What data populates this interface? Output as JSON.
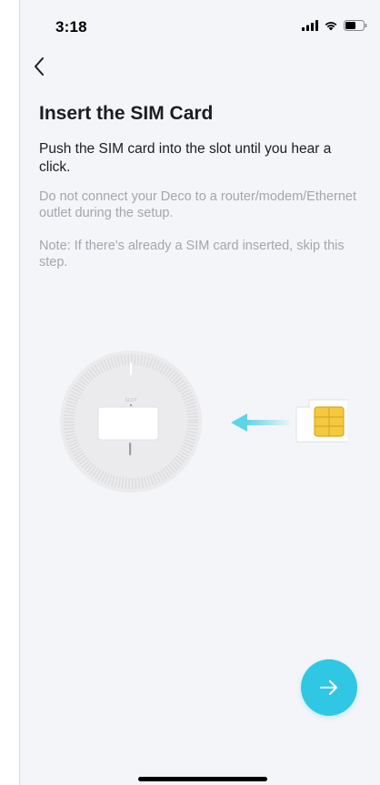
{
  "status_bar": {
    "time": "3:18",
    "icons": [
      "cellular-signal-icon",
      "wifi-icon",
      "battery-icon"
    ]
  },
  "nav": {
    "back_icon": "chevron-left-icon"
  },
  "content": {
    "title": "Insert the SIM Card",
    "instruction": "Push the SIM card into the slot until you hear a click.",
    "warning": "Do not connect your Deco to a router/modem/Ethernet outlet during the setup.",
    "note": "Note: If there's already a SIM card inserted, skip this step."
  },
  "illustration": {
    "slot_label": "SLOT",
    "arrow_color": "#5fd3e8",
    "sim_chip_color": "#f5c842"
  },
  "actions": {
    "next_icon": "arrow-right-icon",
    "next_color": "#30c7e5"
  }
}
